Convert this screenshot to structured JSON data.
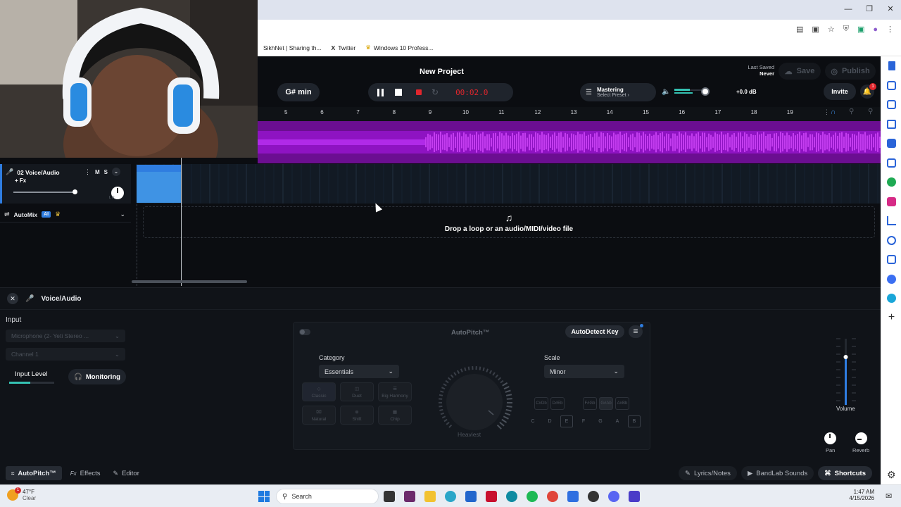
{
  "browser": {
    "bookmarks": [
      "SikhNet | Sharing th...",
      "Twitter",
      "Windows 10 Profess..."
    ]
  },
  "project": {
    "title": "New Project",
    "last_saved_label": "Last Saved",
    "last_saved_value": "Never",
    "save_label": "Save",
    "publish_label": "Publish",
    "invite_label": "Invite",
    "notification_count": "1"
  },
  "transport": {
    "key": "G# min",
    "time": "00:02.0",
    "mastering_title": "Mastering",
    "mastering_preset": "Select Preset",
    "volume_db": "+0.0 dB"
  },
  "ruler": [
    "5",
    "6",
    "7",
    "8",
    "9",
    "10",
    "11",
    "12",
    "13",
    "14",
    "15",
    "16",
    "17",
    "18",
    "19"
  ],
  "tracks": [
    {
      "name": "02  Voice/Audio",
      "fx": "+ Fx",
      "mute": "M",
      "solo": "S",
      "pan_hint": "L   R"
    }
  ],
  "automix": {
    "label": "AutoMix",
    "badge": "AI"
  },
  "dropzone": {
    "text": "Drop a loop or an audio/MIDI/video file"
  },
  "panel": {
    "title": "Voice/Audio",
    "input_heading": "Input",
    "input_device": "Microphone (2- Yeti Stereo ...",
    "channel": "Channel 1",
    "input_level_label": "Input Level",
    "monitoring_label": "Monitoring",
    "autopitch": {
      "title": "AutoPitch™",
      "autodetect_label": "AutoDetect Key",
      "category_label": "Category",
      "category_value": "Essentials",
      "scale_label": "Scale",
      "scale_value": "Minor",
      "knob_label": "Heaviest",
      "effects": [
        "Classic",
        "Duet",
        "Big Harmony",
        "Natural",
        "Shift",
        "Chip"
      ],
      "keys_top": [
        [
          "C#",
          "Db"
        ],
        [
          "D#",
          "Eb"
        ],
        [
          "F#",
          "Gb"
        ],
        [
          "G#",
          "Ab"
        ],
        [
          "A#",
          "Bb"
        ]
      ],
      "keys_bottom": [
        "C",
        "D",
        "E",
        "F",
        "G",
        "A",
        "B"
      ]
    },
    "volume_label": "Volume",
    "pan_label": "Pan",
    "reverb_label": "Reverb"
  },
  "bottom_tabs": {
    "autopitch": "AutoPitch™",
    "effects": "Effects",
    "editor": "Editor",
    "lyrics": "Lyrics/Notes",
    "sounds": "BandLab Sounds",
    "shortcuts": "Shortcuts"
  },
  "taskbar": {
    "weather_temp": "47°F",
    "weather_desc": "Clear",
    "search_placeholder": "Search",
    "time": "1:47 AM",
    "date": "4/15/2026",
    "weather_badge": "1"
  },
  "colors": {
    "waveform": "#a10fd6",
    "clip": "#3f93e4",
    "accent_blue": "#2f7de0",
    "record": "#e0262d",
    "time": "#e0262d"
  }
}
